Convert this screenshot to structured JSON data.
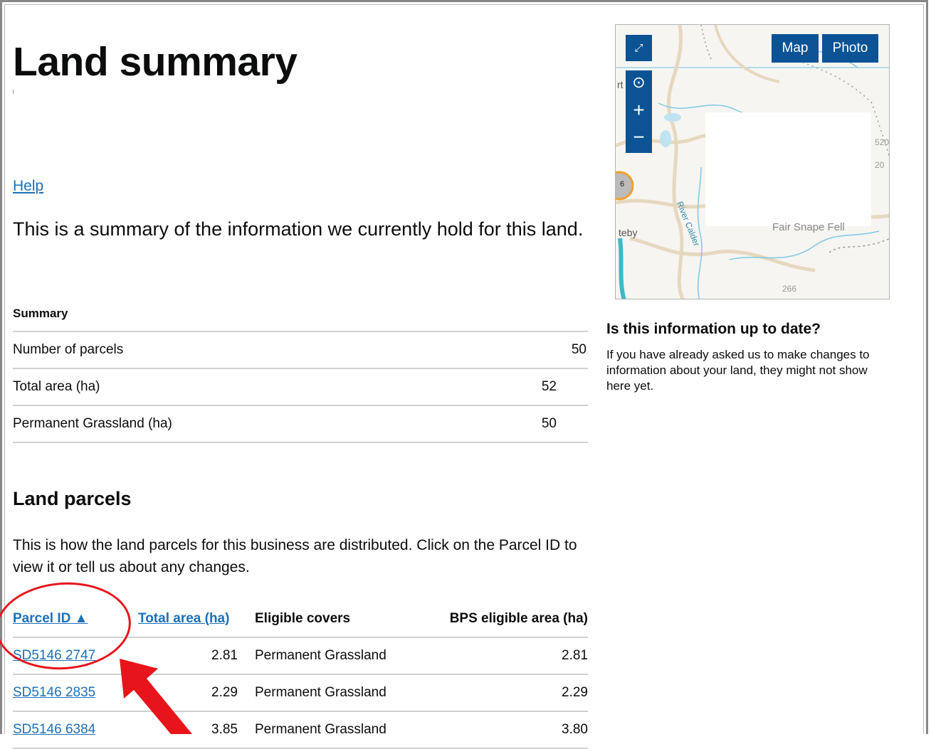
{
  "page": {
    "title": "Land summary",
    "help_link": "Help",
    "intro": "This is a summary of the information we currently hold for this land."
  },
  "summary": {
    "caption": "Summary",
    "rows": [
      {
        "label": "Number of parcels",
        "value": "50"
      },
      {
        "label": "Total area (ha)",
        "value": "52"
      },
      {
        "label": "Permanent Grassland (ha)",
        "value": "50"
      }
    ]
  },
  "parcels": {
    "heading": "Land parcels",
    "intro": "This is how the land parcels for this business are distributed. Click on the Parcel ID to view it or tell us about any changes.",
    "columns": {
      "parcel_id": "Parcel ID ▲",
      "total_area": "Total area (ha)",
      "eligible_covers": "Eligible covers",
      "bps_area": "BPS eligible area (ha)"
    },
    "rows": [
      {
        "id": "SD5146 2747",
        "area": "2.81",
        "cover": "Permanent Grassland",
        "bps": "2.81"
      },
      {
        "id": "SD5146 2835",
        "area": "2.29",
        "cover": "Permanent Grassland",
        "bps": "2.29"
      },
      {
        "id": "SD5146 6384",
        "area": "3.85",
        "cover": "Permanent Grassland",
        "bps": "3.80"
      }
    ]
  },
  "map": {
    "map_button": "Map",
    "photo_button": "Photo",
    "labels": {
      "river": "River Calder",
      "fell": "Fair Snape Fell",
      "teby": "teby",
      "rt": "rt",
      "spot": "266",
      "cluster": "6",
      "h520": "520",
      "h20": "20"
    }
  },
  "update_notice": {
    "title": "Is this information up to date?",
    "text": "If you have already asked us to make changes to information about your land, they might not show here yet."
  },
  "colors": {
    "link": "#1d70b8",
    "map_button": "#0b5394",
    "annotation": "#e8141c"
  }
}
